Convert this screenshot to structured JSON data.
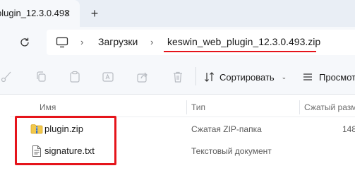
{
  "tab": {
    "title": "plugin_12.3.0.493",
    "close_glyph": "✕",
    "new_tab_glyph": "+"
  },
  "address": {
    "separator": "›",
    "breadcrumbs": [
      "Загрузки",
      "keswin_web_plugin_12.3.0.493.zip"
    ]
  },
  "commands": {
    "sort_label": "Сортировать",
    "sort_chevron": "⌄",
    "view_label": "Просмотр",
    "icons": [
      "cut-icon",
      "copy-icon",
      "paste-icon",
      "rename-icon",
      "share-icon",
      "delete-icon",
      "sort-icon",
      "view-icon"
    ]
  },
  "columns": {
    "name": "Имя",
    "type": "Тип",
    "size": "Сжатый разм"
  },
  "files": [
    {
      "name": "plugin.zip",
      "type": "Сжатая ZIP-папка",
      "size": "148",
      "icon": "zip-folder-icon"
    },
    {
      "name": "signature.txt",
      "type": "Текстовый документ",
      "size": "",
      "icon": "text-file-icon"
    }
  ],
  "colors": {
    "highlight_red": "#e5141b",
    "chrome_bg": "#f6f8fb",
    "tabstrip_bg": "#e9eef5"
  }
}
